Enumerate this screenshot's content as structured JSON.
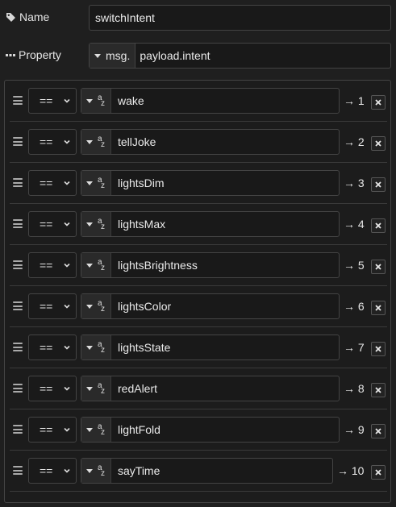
{
  "name": {
    "label": "Name",
    "value": "switchIntent"
  },
  "property": {
    "label": "Property",
    "prefix": "msg.",
    "value": "payload.intent"
  },
  "rules": [
    {
      "op": "==",
      "value": "wake",
      "output": "→ 1"
    },
    {
      "op": "==",
      "value": "tellJoke",
      "output": "→ 2"
    },
    {
      "op": "==",
      "value": "lightsDim",
      "output": "→ 3"
    },
    {
      "op": "==",
      "value": "lightsMax",
      "output": "→ 4"
    },
    {
      "op": "==",
      "value": "lightsBrightness",
      "output": "→ 5"
    },
    {
      "op": "==",
      "value": "lightsColor",
      "output": "→ 6"
    },
    {
      "op": "==",
      "value": "lightsState",
      "output": "→ 7"
    },
    {
      "op": "==",
      "value": "redAlert",
      "output": "→ 8"
    },
    {
      "op": "==",
      "value": "lightFold",
      "output": "→ 9"
    },
    {
      "op": "==",
      "value": "sayTime",
      "output": "→ 10"
    }
  ],
  "type_glyph": {
    "top": "a",
    "bottom": "z"
  },
  "icons": {
    "name": "tag-icon",
    "property": "ellipsis-icon",
    "drag": "drag-handle-icon",
    "delete": "close-icon",
    "dropdown": "chevron-down-icon"
  }
}
